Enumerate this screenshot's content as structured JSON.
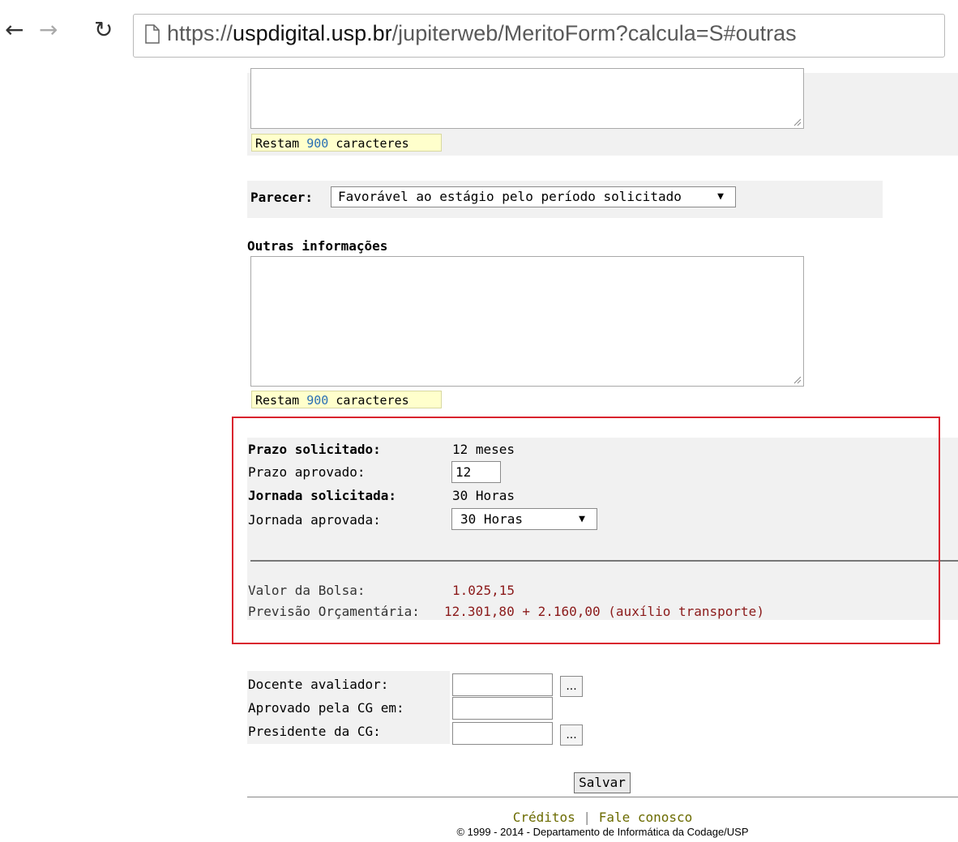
{
  "browser": {
    "url_prefix": "https://",
    "url_host": "uspdigital.usp.br",
    "url_path": "/jupiterweb/MeritoForm?calcula=S#outras"
  },
  "top_textarea": {
    "counter_prefix": "Restam",
    "counter_value": "900",
    "counter_suffix": "caracteres"
  },
  "parecer": {
    "label": "Parecer:",
    "selected": "Favorável ao estágio pelo período solicitado"
  },
  "outras": {
    "heading": "Outras informações",
    "counter_prefix": "Restam",
    "counter_value": "900",
    "counter_suffix": "caracteres"
  },
  "prazo": {
    "solicitado_label": "Prazo solicitado:",
    "solicitado_value": "12 meses",
    "aprovado_label": "Prazo aprovado:",
    "aprovado_value": "12",
    "jornada_solicitada_label": "Jornada solicitada:",
    "jornada_solicitada_value": "30 Horas",
    "jornada_aprovada_label": "Jornada aprovada:",
    "jornada_aprovada_value": "30 Horas",
    "valor_bolsa_label": "Valor da Bolsa:",
    "valor_bolsa_value": "1.025,15",
    "previsao_label": "Previsão Orçamentária:",
    "previsao_value": "12.301,80 + 2.160,00 (auxílio transporte)"
  },
  "avaliacao": {
    "docente_label": "Docente avaliador:",
    "aprovado_cg_label": "Aprovado pela CG em:",
    "presidente_label": "Presidente da CG:",
    "lookup_label": "...",
    "salvar": "Salvar"
  },
  "footer": {
    "creditos": "Créditos",
    "separator": "|",
    "fale": "Fale conosco",
    "copyright": "© 1999 - 2014 - Departamento de Informática da Codage/USP"
  },
  "colors": {
    "highlight_border": "#d9232e",
    "value_red": "#8b1a1a",
    "link": "#2a6fb4",
    "footer_link": "#6b6b00"
  }
}
